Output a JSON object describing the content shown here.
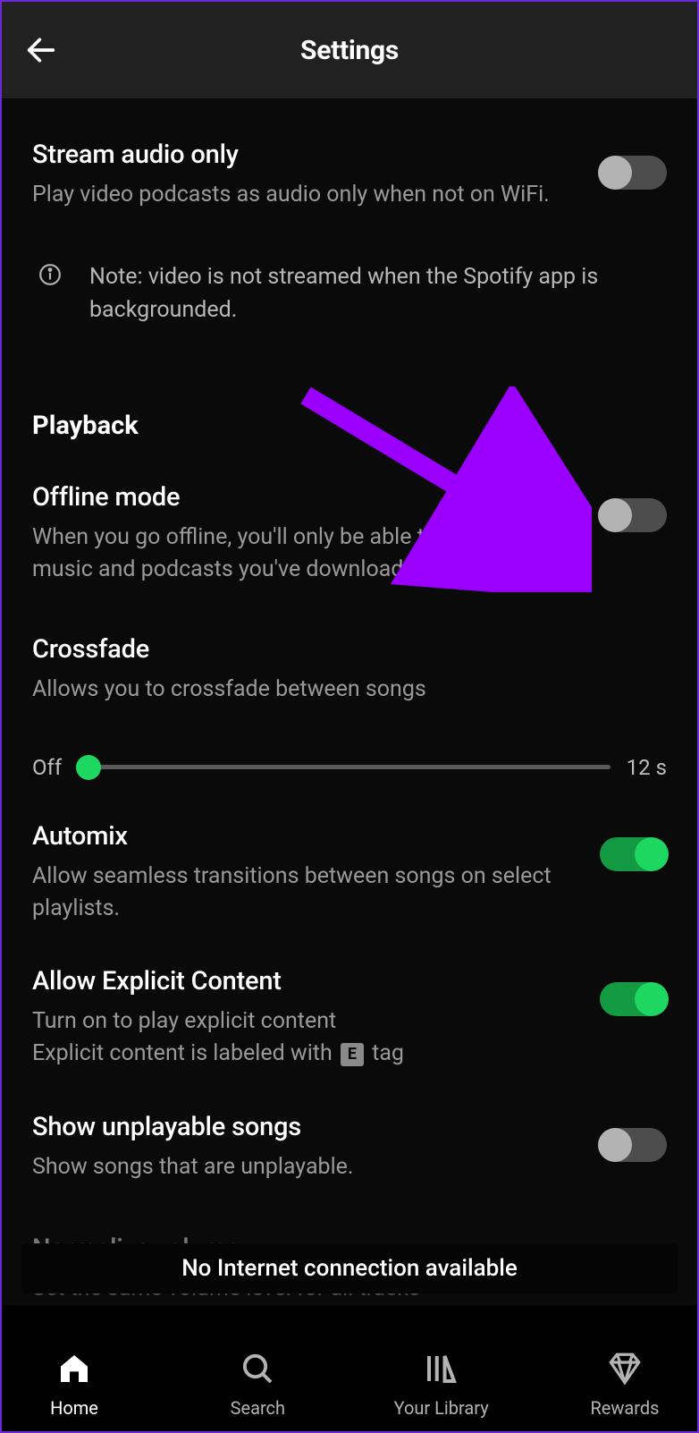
{
  "header": {
    "title": "Settings"
  },
  "settings": {
    "stream_audio": {
      "title": "Stream audio only",
      "desc": "Play video podcasts as audio only when not on WiFi.",
      "value": false
    },
    "note": "Note: video is not streamed when the Spotify app is backgrounded.",
    "playback_section": "Playback",
    "offline": {
      "title": "Offline mode",
      "desc": "When you go offline, you'll only be able to play the music and podcasts you've downloaded.",
      "value": false
    },
    "crossfade": {
      "title": "Crossfade",
      "desc": "Allows you to crossfade between songs",
      "min_label": "Off",
      "max_label": "12 s",
      "value": 0
    },
    "automix": {
      "title": "Automix",
      "desc": "Allow seamless transitions between songs on select playlists.",
      "value": true
    },
    "explicit": {
      "title": "Allow Explicit Content",
      "desc_1": "Turn on to play explicit content",
      "desc_2a": "Explicit content is labeled with ",
      "desc_2b": " tag",
      "e_label": "E",
      "value": true
    },
    "unplayable": {
      "title": "Show unplayable songs",
      "desc": "Show songs that are unplayable.",
      "value": false
    },
    "normalize": {
      "title": "Normalize volume",
      "desc": "Set the same volume level for all tracks",
      "value": true
    }
  },
  "toast": "No Internet connection available",
  "nav": {
    "home": "Home",
    "search": "Search",
    "library": "Your Library",
    "rewards": "Rewards"
  }
}
